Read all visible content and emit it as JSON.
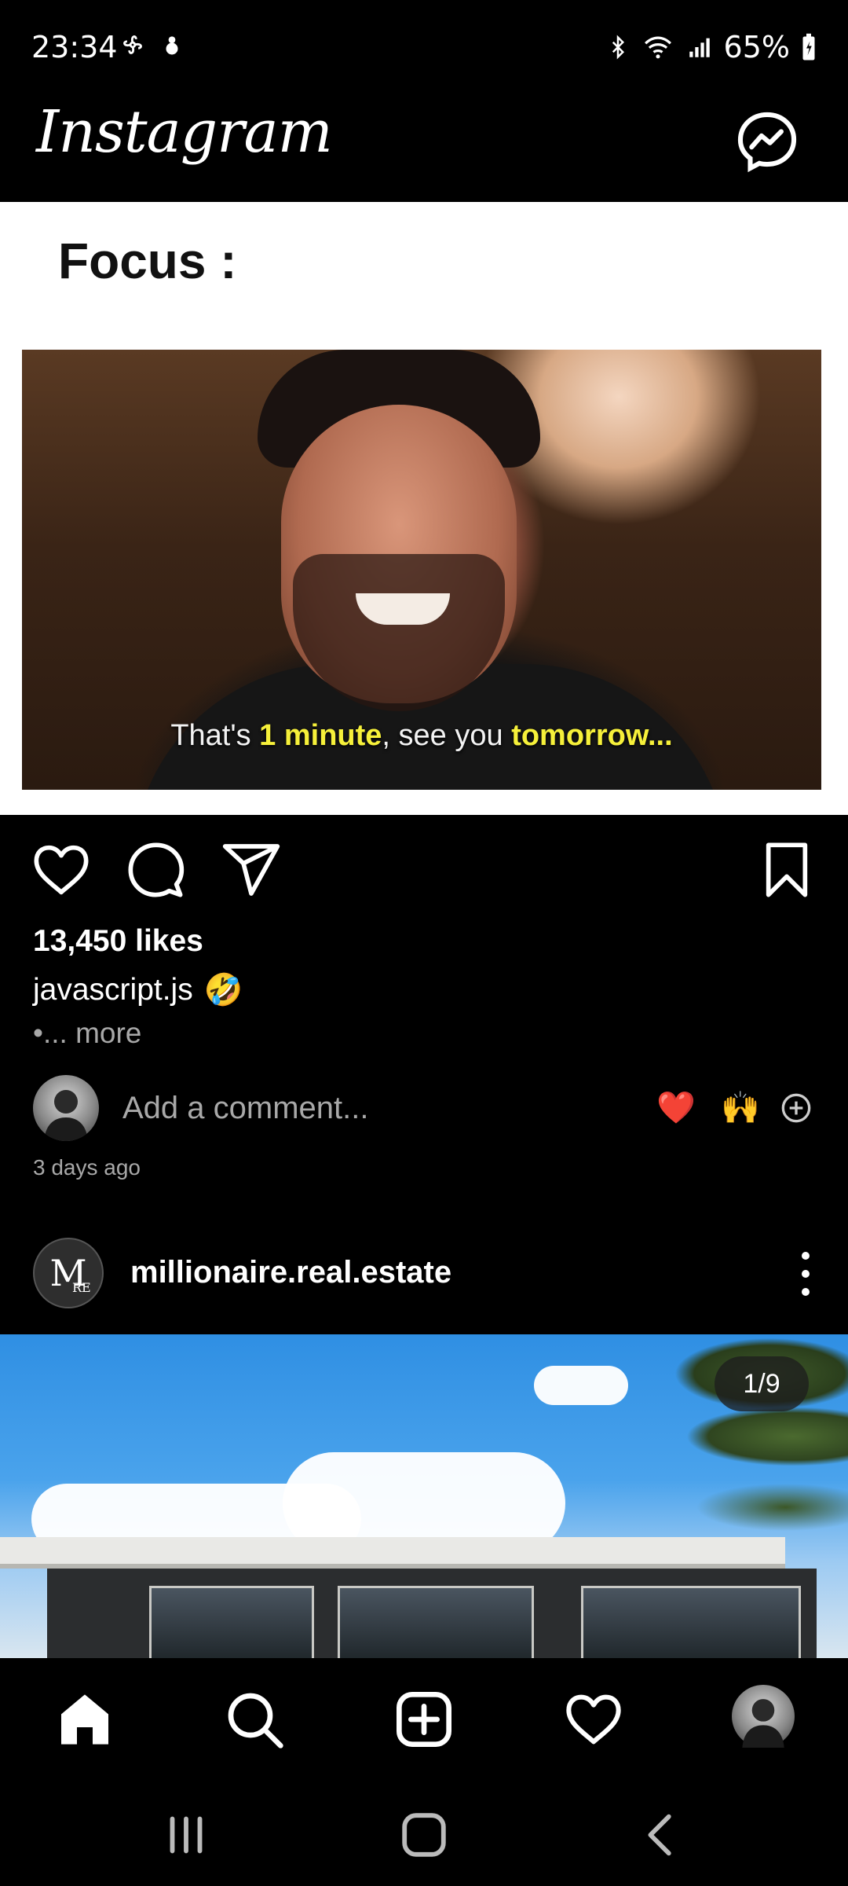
{
  "status_bar": {
    "time": "23:34",
    "battery": "65%"
  },
  "header": {
    "logo": "Instagram",
    "messenger_icon": "messenger-icon"
  },
  "post1": {
    "image_heading": "Focus :",
    "subtitle_parts": [
      "That's ",
      "1 minute",
      ", see you ",
      "tomorrow..."
    ],
    "likes": "13,450 likes",
    "caption_user": "javascript.js",
    "caption_emoji": "🤣",
    "more": "•... more",
    "comment_placeholder": "Add a comment...",
    "quick_emojis": [
      "❤️",
      "🙌"
    ],
    "time_ago": "3 days ago"
  },
  "post2": {
    "avatar_text": "M",
    "avatar_subtext": "RE",
    "username": "millionaire.real.estate",
    "carousel_counter": "1/9"
  },
  "bottom_nav": [
    "home-icon",
    "search-icon",
    "add-post-icon",
    "activity-heart-icon",
    "profile-avatar"
  ],
  "system_nav": [
    "recent-apps-icon",
    "home-button-icon",
    "back-icon"
  ]
}
